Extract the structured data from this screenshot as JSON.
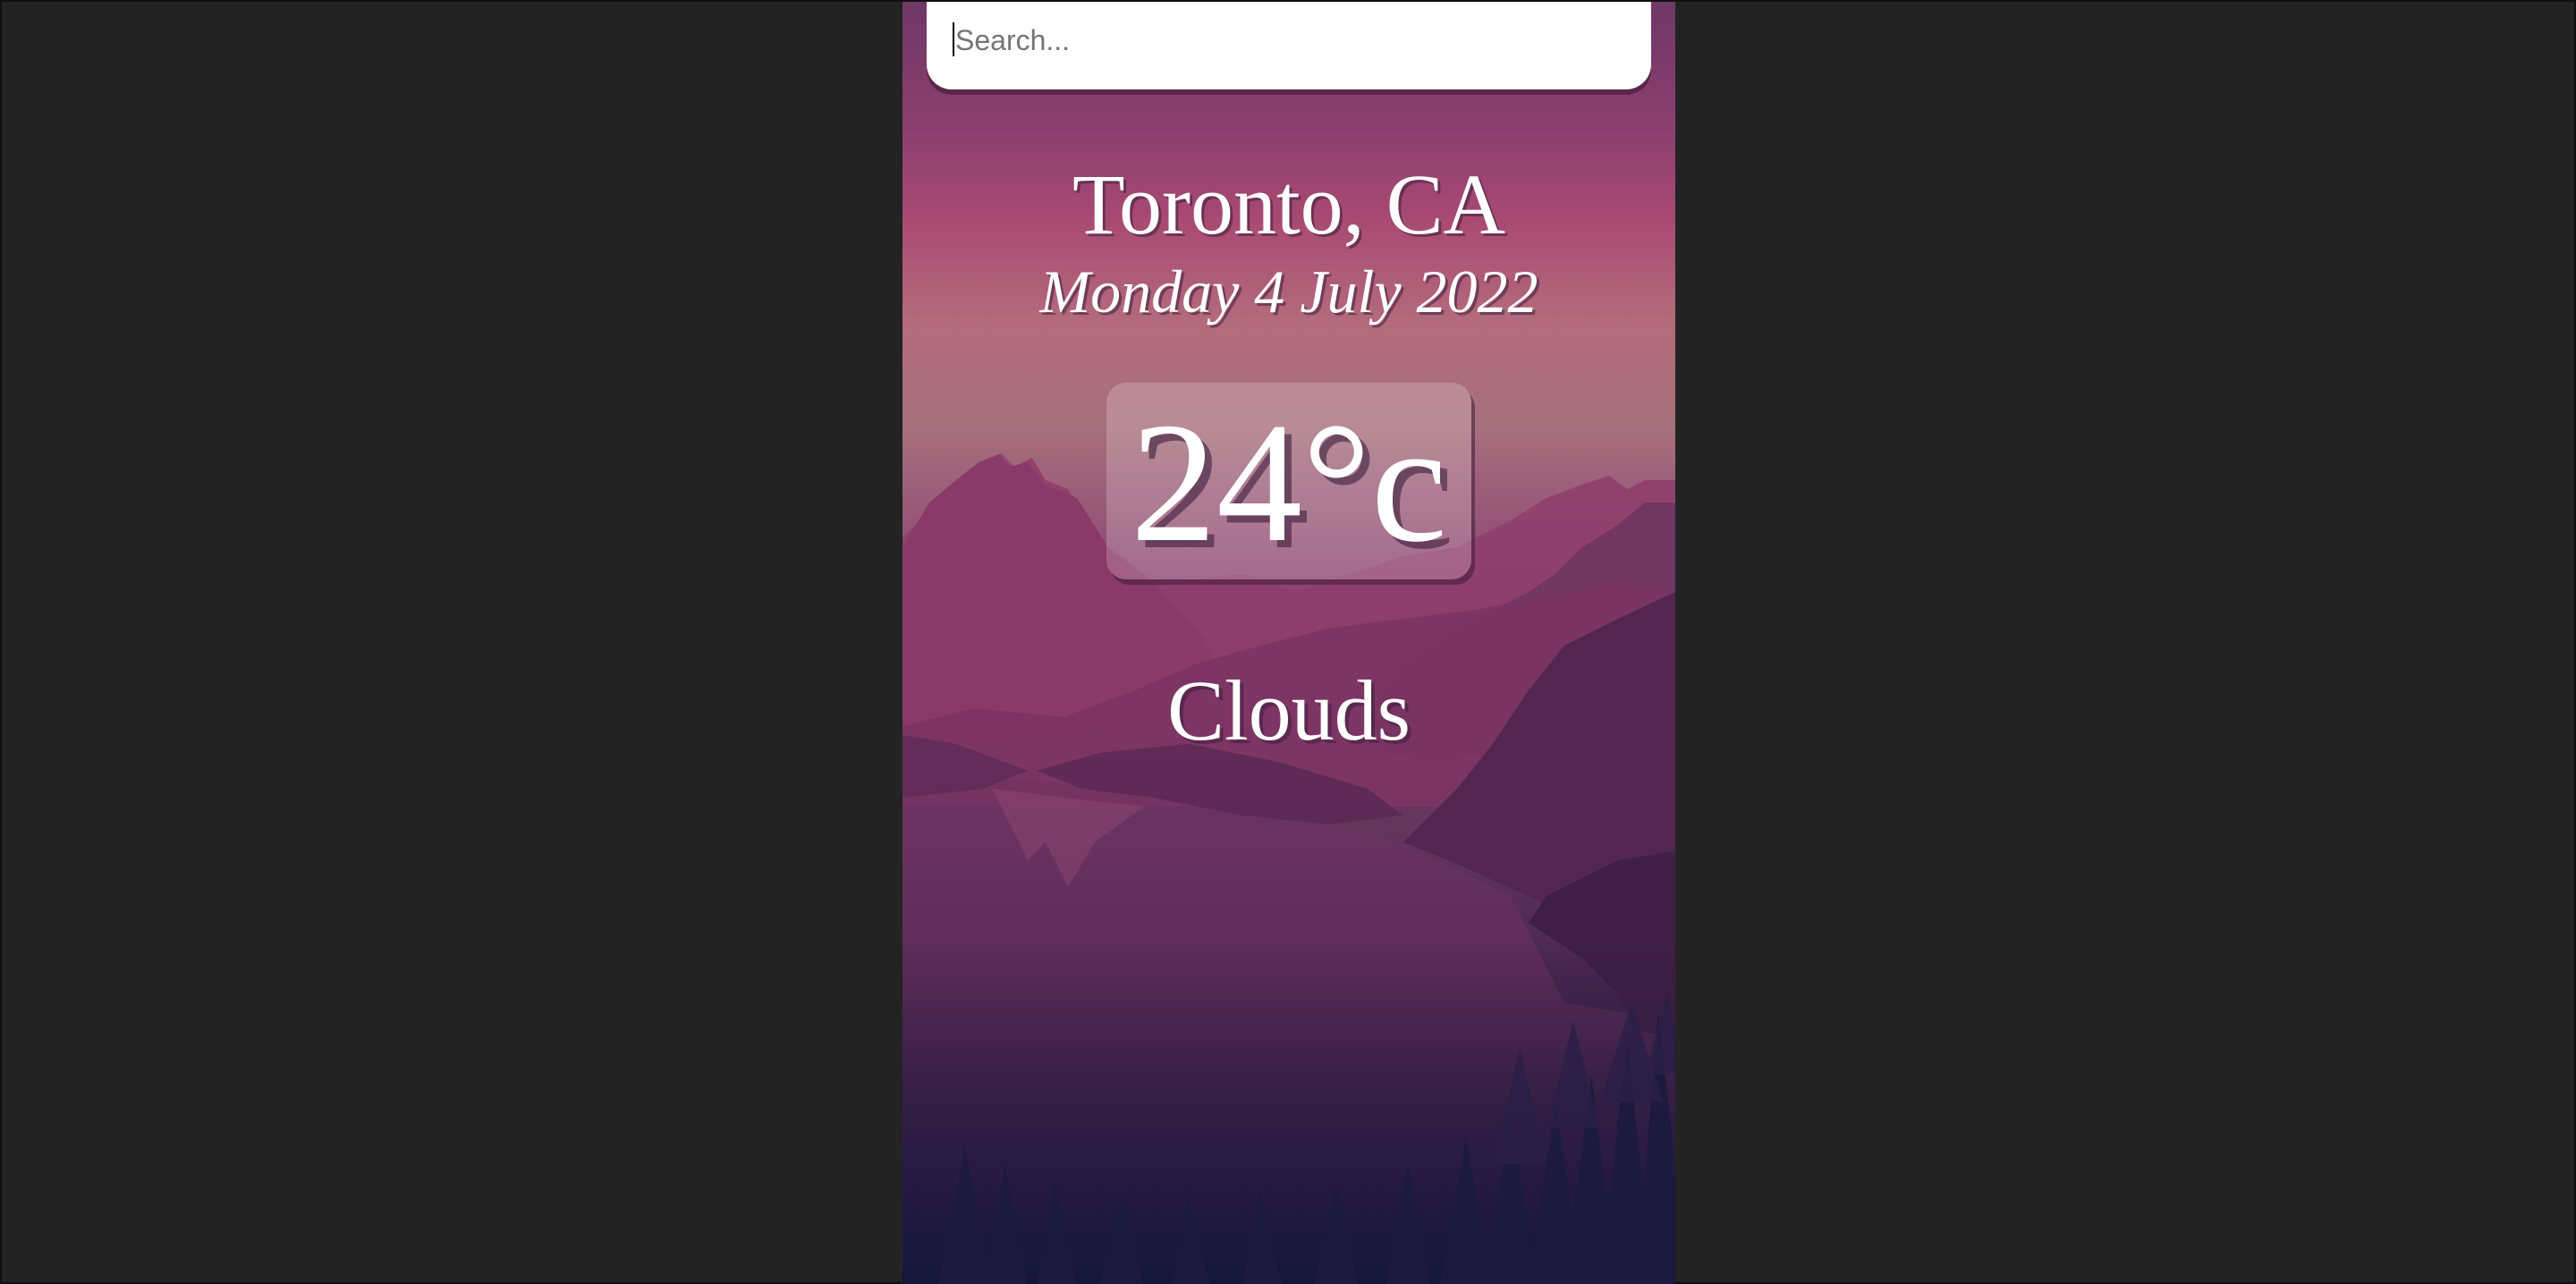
{
  "search": {
    "placeholder": "Search...",
    "value": ""
  },
  "weather": {
    "location": "Toronto, CA",
    "date": "Monday 4 July 2022",
    "temperature": "24°c",
    "condition": "Clouds"
  },
  "colors": {
    "page_background": "#232323",
    "sky_top": "#6e3866",
    "sky_pink": "#a84a72",
    "horizon": "#b36b7c",
    "ground_dark": "#15163a",
    "text": "#ffffff"
  }
}
